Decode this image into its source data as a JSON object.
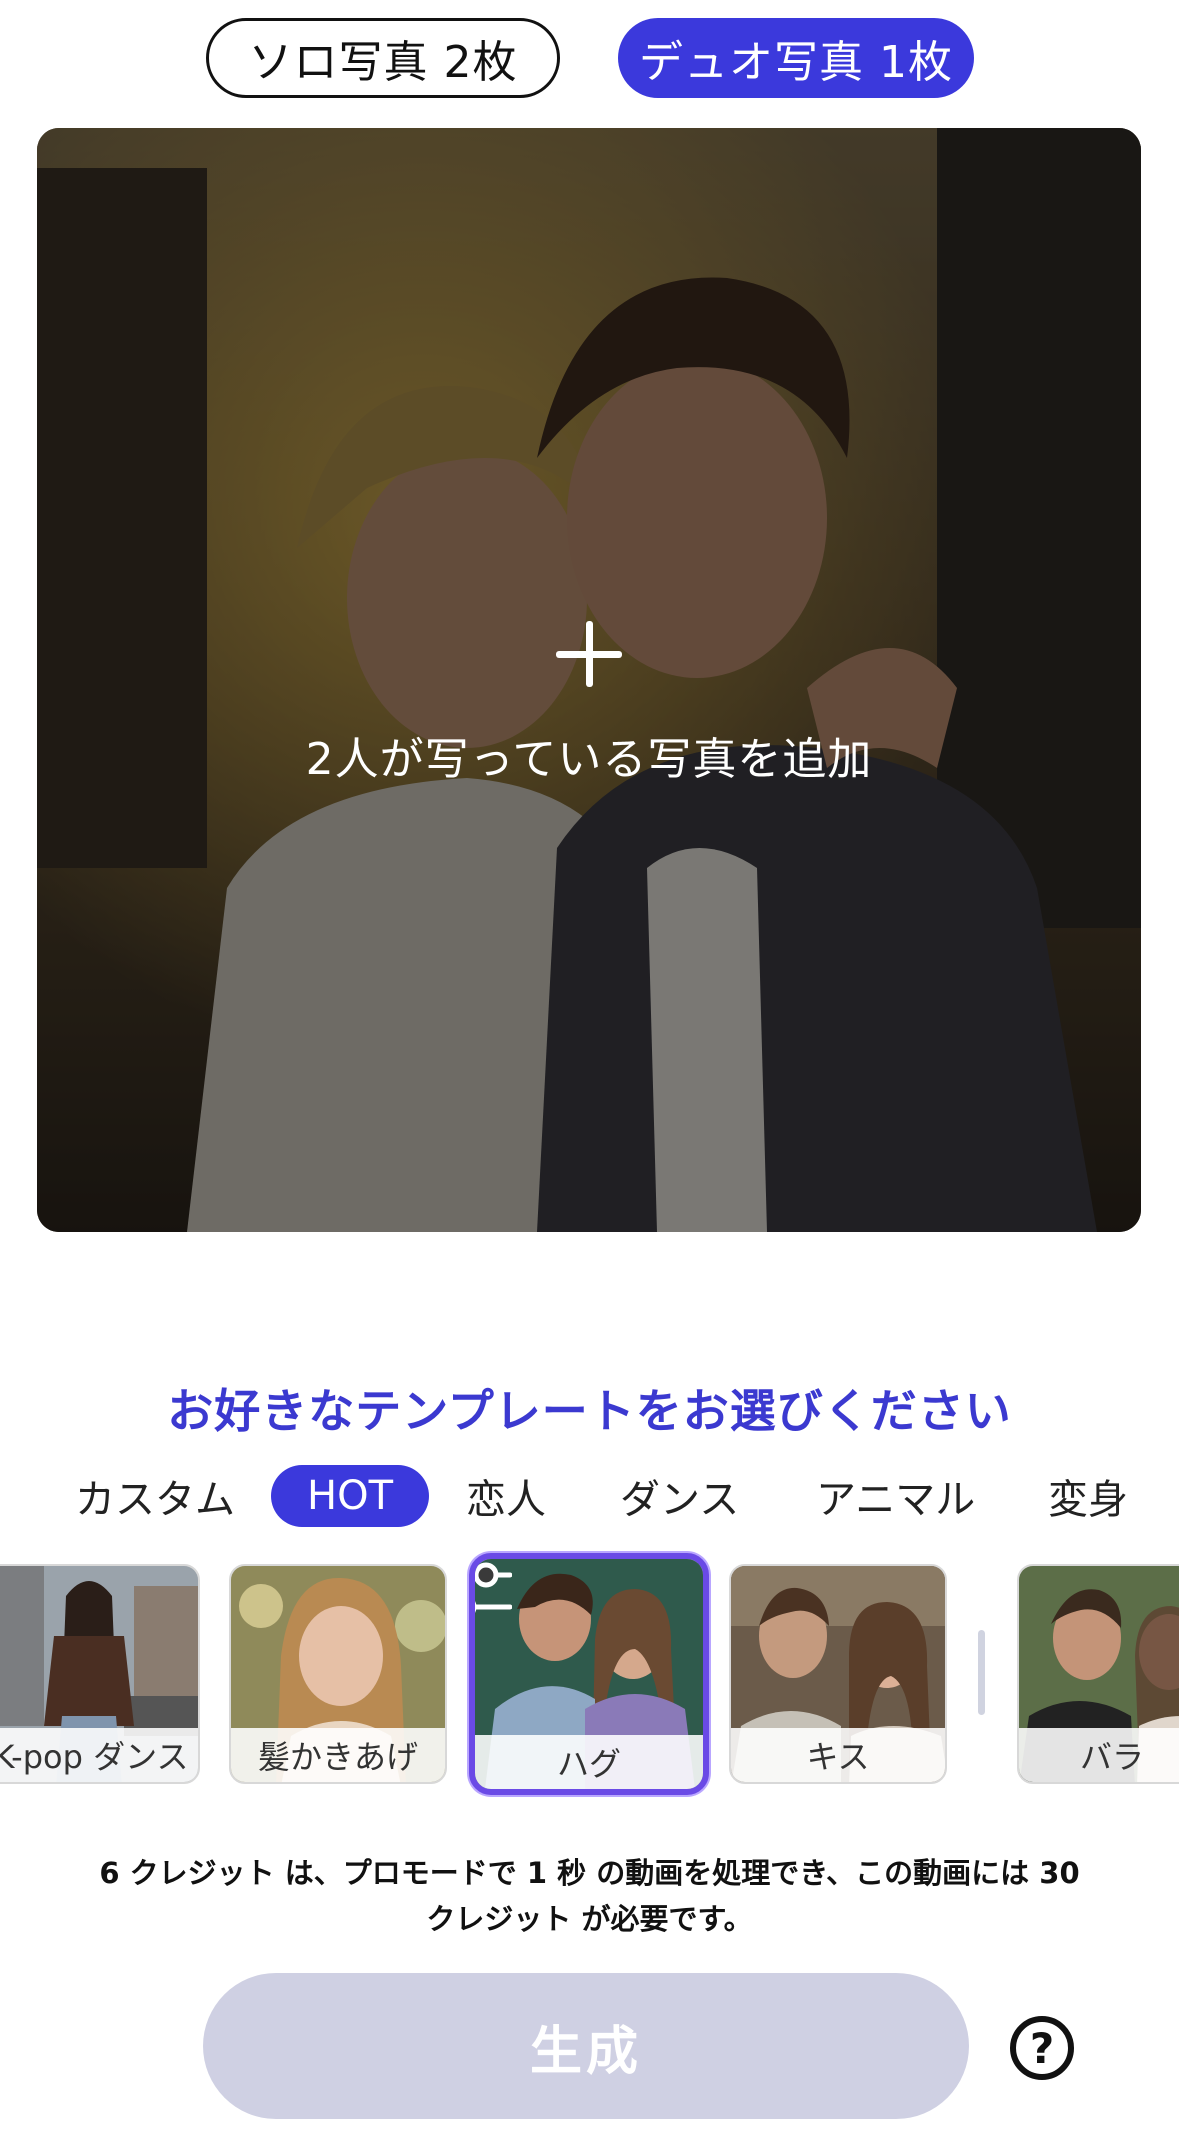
{
  "mode_toggle": {
    "solo_label": "ソロ写真 2枚",
    "duo_label": "デュオ写真 1枚",
    "active": "duo"
  },
  "photo": {
    "add_label": "2人が写っている写真を追加",
    "plus_icon": "plus-icon"
  },
  "templates": {
    "heading": "お好きなテンプレートをお選びください",
    "categories": [
      "カスタム",
      "HOT",
      "恋人",
      "ダンス",
      "アニマル",
      "変身"
    ],
    "active_category": "HOT",
    "cards": [
      {
        "label": "K-pop ダンス"
      },
      {
        "label": "髪かきあげ"
      },
      {
        "label": "ハグ",
        "selected": true
      },
      {
        "label": "キス"
      },
      {
        "label": "バラ"
      }
    ]
  },
  "credit_note": "6 クレジット は、プロモードで 1 秒 の動画を処理でき、この動画には 30 クレジット が必要です。",
  "generate_label": "生成",
  "help_icon": "question-circle-icon",
  "colors": {
    "accent": "#3b39dc",
    "heading": "#3b39d0",
    "generate_disabled": "#cfd0e3"
  }
}
